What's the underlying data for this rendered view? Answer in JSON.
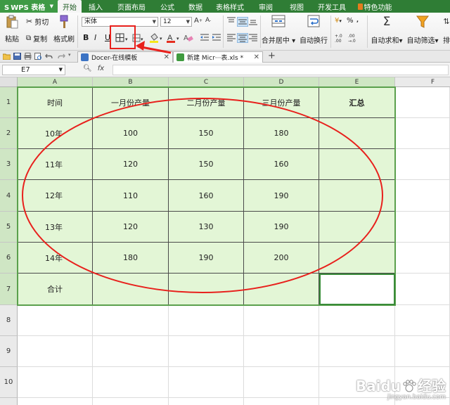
{
  "app": {
    "name": "WPS 表格",
    "logo": "S"
  },
  "menu_tabs": [
    {
      "label": "开始",
      "active": true
    },
    {
      "label": "插入"
    },
    {
      "label": "页面布局"
    },
    {
      "label": "公式"
    },
    {
      "label": "数据"
    },
    {
      "label": "表格样式"
    },
    {
      "label": "审阅"
    },
    {
      "label": "视图"
    },
    {
      "label": "开发工具"
    },
    {
      "label": "特色功能",
      "special": true
    }
  ],
  "ribbon": {
    "paste": "粘贴",
    "cut": "剪切",
    "copy": "复制",
    "format_painter": "格式刷",
    "font_name": "宋体",
    "font_size": "12",
    "bold": "B",
    "italic": "I",
    "underline": "U",
    "merge_center": "合并居中",
    "wrap_text": "自动换行",
    "percent": "%",
    "autosum": "自动求和",
    "autofilter": "自动筛选",
    "sort": "排"
  },
  "doc_tabs": [
    {
      "label": "Docer-在线模板",
      "active": false
    },
    {
      "label": "新建 Micr···表.xls *",
      "active": true
    }
  ],
  "formula_bar": {
    "cell_ref": "E7",
    "fx": "fx",
    "value": ""
  },
  "columns": [
    "A",
    "B",
    "C",
    "D",
    "E",
    "F"
  ],
  "rows": [
    "1",
    "2",
    "3",
    "4",
    "5",
    "6",
    "7",
    "8",
    "9",
    "10"
  ],
  "table": {
    "header": [
      "时间",
      "一月份产量",
      "二月份产量",
      "三月份产量",
      "汇总"
    ],
    "body": [
      [
        "10年",
        "100",
        "150",
        "180",
        ""
      ],
      [
        "11年",
        "120",
        "150",
        "160",
        ""
      ],
      [
        "12年",
        "110",
        "160",
        "190",
        ""
      ],
      [
        "13年",
        "120",
        "130",
        "190",
        ""
      ],
      [
        "14年",
        "180",
        "190",
        "200",
        ""
      ],
      [
        "合计",
        "",
        "",
        "",
        ""
      ]
    ]
  },
  "watermark": {
    "brand": "Baidu",
    "sub": "经验",
    "url": "jingyan.baidu.com"
  },
  "colors": {
    "accent_green": "#2f7d35",
    "cell_fill": "#e3f6d6",
    "annotation_red": "#e8201c"
  }
}
